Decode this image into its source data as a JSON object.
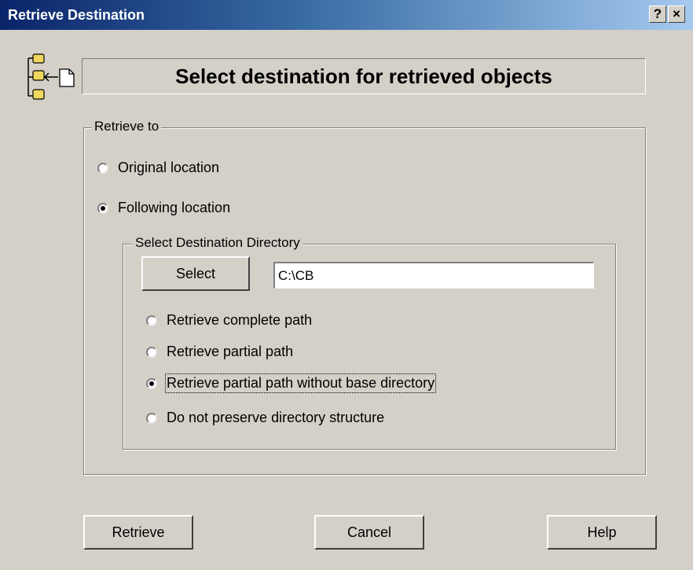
{
  "window": {
    "title": "Retrieve Destination",
    "help_glyph": "?",
    "close_glyph": "×"
  },
  "banner": {
    "text": "Select destination for retrieved objects",
    "icon": "folder-tree-retrieve-icon"
  },
  "retrieve_to": {
    "legend": "Retrieve to",
    "options": [
      {
        "label": "Original location",
        "checked": false
      },
      {
        "label": "Following location",
        "checked": true
      }
    ]
  },
  "destination": {
    "legend": "Select Destination Directory",
    "select_label": "Select",
    "path_value": "C:\\CB",
    "options": [
      {
        "label": "Retrieve complete path",
        "checked": false
      },
      {
        "label": "Retrieve partial path",
        "checked": false
      },
      {
        "label": "Retrieve partial path without base directory",
        "checked": true
      },
      {
        "label": "Do not preserve directory structure",
        "checked": false
      }
    ]
  },
  "buttons": {
    "retrieve": "Retrieve",
    "cancel": "Cancel",
    "help": "Help"
  }
}
